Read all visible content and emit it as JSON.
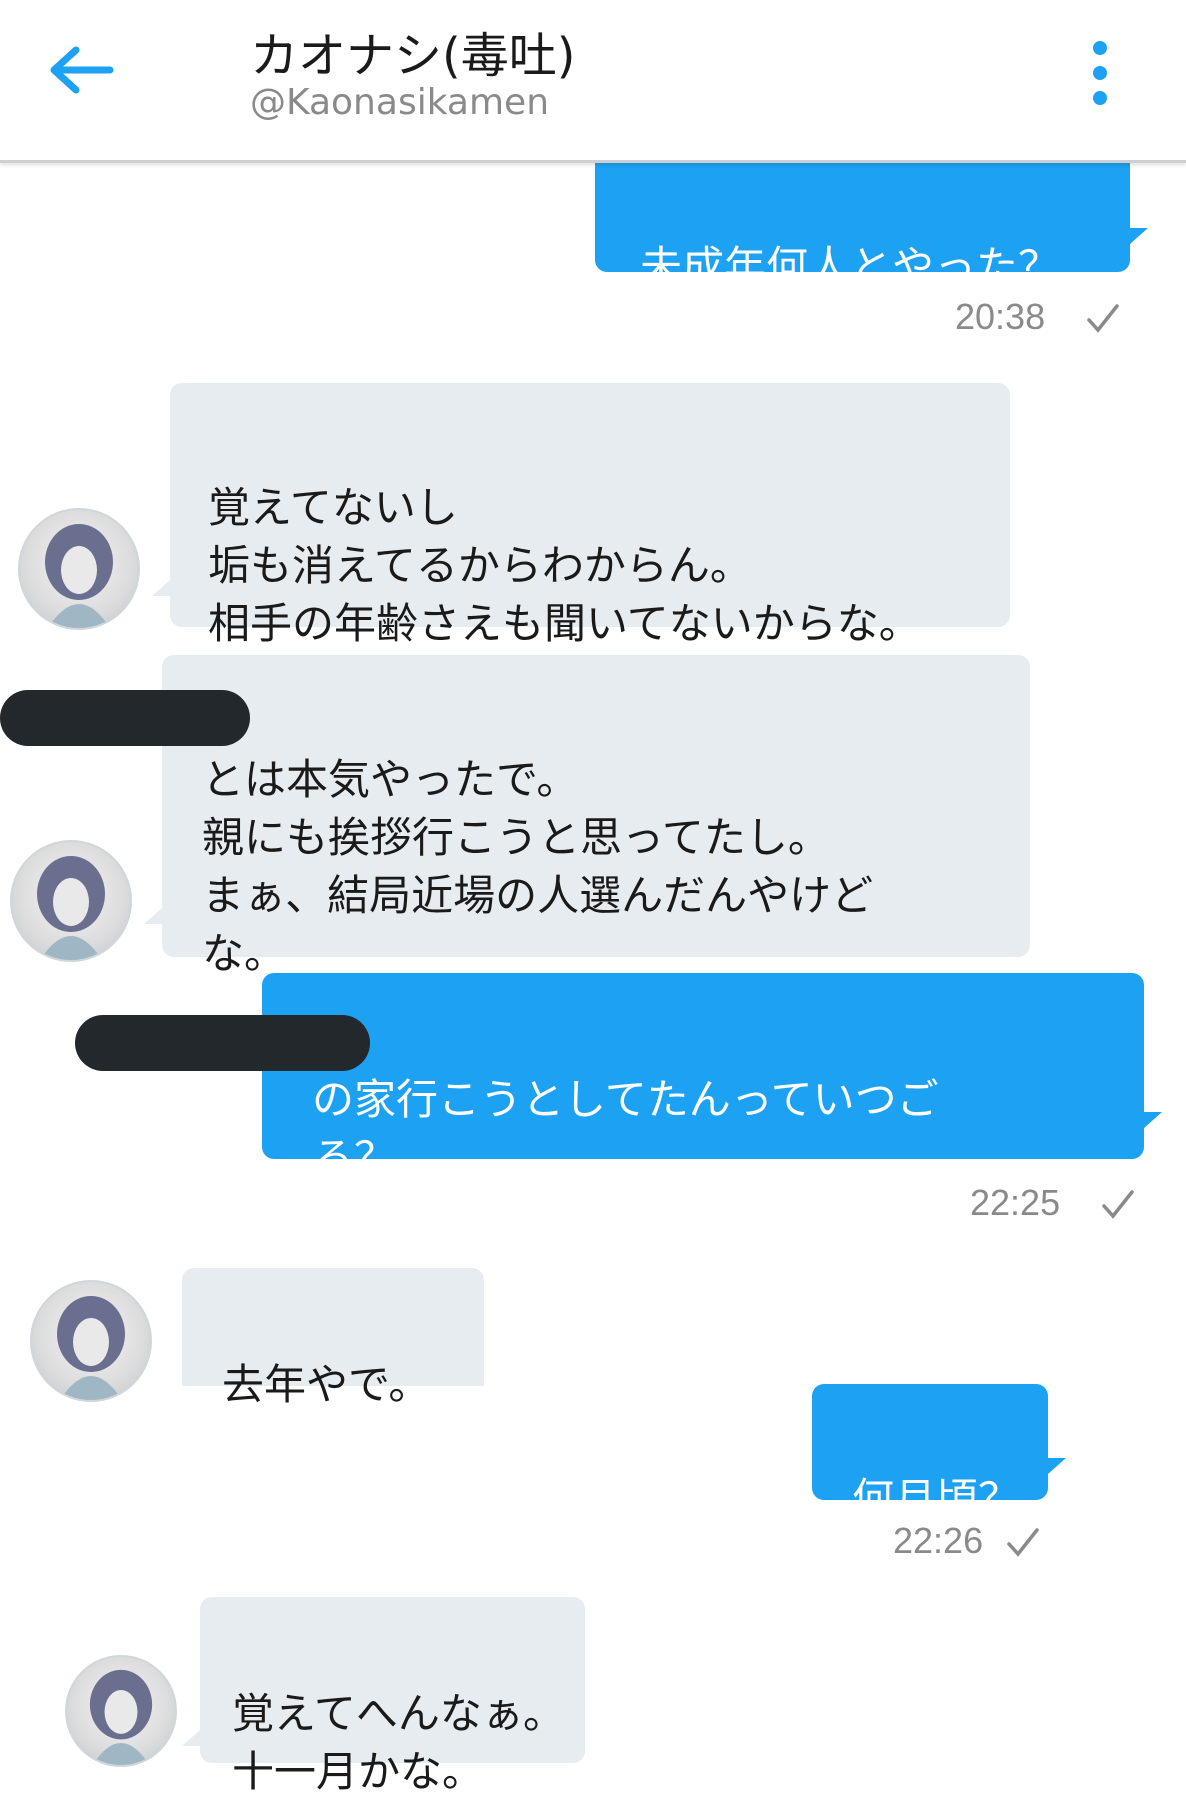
{
  "header": {
    "title": "カオナシ(毒吐)",
    "handle": "@Kaonasikamen",
    "back_icon": "arrow-left-icon",
    "menu_icon": "more-vertical-icon"
  },
  "colors": {
    "accent": "#1da1f2",
    "incoming_bubble": "#e6ecf0",
    "timestamp": "#8a8a8a"
  },
  "messages": [
    {
      "direction": "out",
      "text": "未成年何人とやった？",
      "time": "20:38"
    },
    {
      "direction": "in",
      "text": "覚えてないし\n垢も消えてるからわからん。\n相手の年齢さえも聞いてないからな。"
    },
    {
      "direction": "in",
      "text": "とは本気やったで。\n親にも挨拶行こうと思ってたし。\nまぁ、結局近場の人選んだんやけど\nな。"
    },
    {
      "direction": "out",
      "text": "の家行こうとしてたんっていつご\nろ？",
      "time": "22:25"
    },
    {
      "direction": "in",
      "text": "去年やで。"
    },
    {
      "direction": "out",
      "text": "何月頃？",
      "time": "22:26"
    },
    {
      "direction": "in",
      "text": "覚えてへんなぁ。\n十一月かな。"
    }
  ]
}
